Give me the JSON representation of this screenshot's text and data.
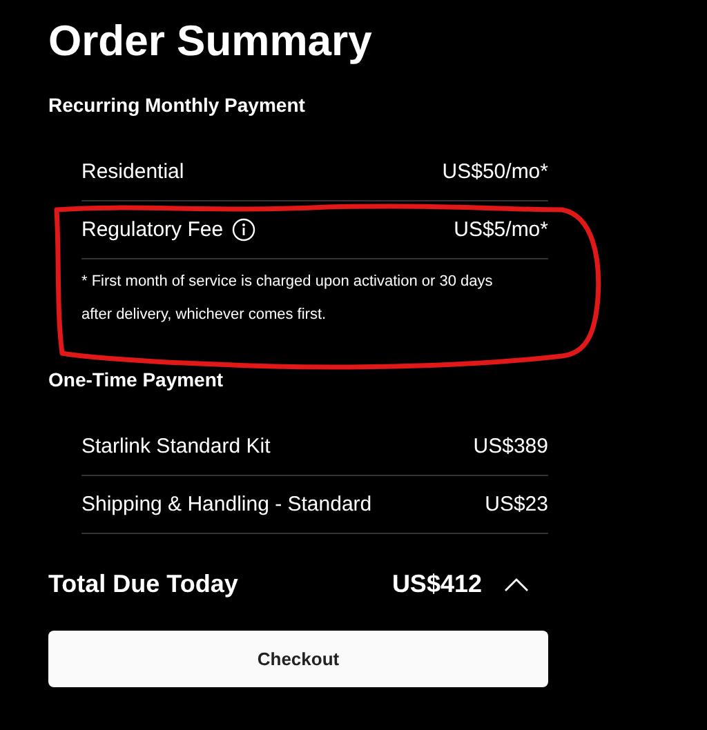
{
  "title": "Order Summary",
  "sections": [
    {
      "heading": "Recurring Monthly Payment",
      "items": [
        {
          "label": "Residential",
          "price": "US$50/mo*",
          "info": false
        },
        {
          "label": "Regulatory Fee",
          "price": "US$5/mo*",
          "info": true
        }
      ],
      "note": "* First month of service is charged upon activation or 30 days after delivery, whichever comes first.",
      "annotation": {
        "kind": "circled"
      }
    },
    {
      "heading": "One-Time Payment",
      "items": [
        {
          "label": "Starlink Standard Kit",
          "price": "US$389",
          "info": false
        },
        {
          "label": "Shipping & Handling - Standard",
          "price": "US$23",
          "info": false
        }
      ]
    }
  ],
  "total": {
    "label": "Total Due Today",
    "amount": "US$412",
    "expanded": true
  },
  "button": "Checkout"
}
